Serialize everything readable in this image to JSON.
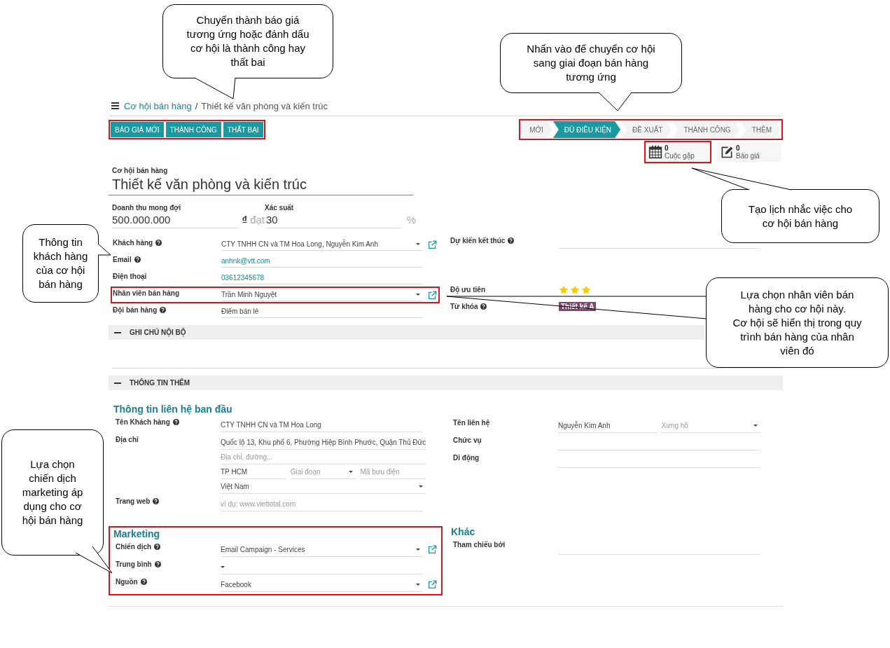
{
  "breadcrumb": {
    "parent": "Cơ hội bán hàng",
    "separator": "/",
    "current": "Thiết kế văn phòng và kiến trúc"
  },
  "action_bar": {
    "highlighted": true,
    "buttons": [
      "BÁO GIÁ MỚI",
      "THÀNH CÔNG",
      "THẤT BẠI"
    ]
  },
  "stage_bar": {
    "highlighted": true,
    "stages": [
      {
        "label": "MỚI",
        "selected": false
      },
      {
        "label": "ĐỦ ĐIỀU KIỆN",
        "selected": true
      },
      {
        "label": "ĐỀ XUẤT",
        "selected": false
      },
      {
        "label": "THÀNH CÔNG",
        "selected": false
      },
      {
        "label": "THÊM",
        "selected": false
      }
    ]
  },
  "smart_buttons": [
    {
      "kind": "calendar",
      "count": "0",
      "label": "Cuộc gặp",
      "highlighted": true
    },
    {
      "kind": "quote",
      "count": "0",
      "label": "Báo giá",
      "highlighted": false
    }
  ],
  "opportunity": {
    "label": "Cơ hội bán hàng",
    "title": "Thiết kế văn phòng và kiến trúc"
  },
  "revenue": {
    "label": "Doanh thu mong đợi",
    "value": "500.000.000",
    "currency": "₫",
    "connector": "đạt"
  },
  "probability": {
    "label": "Xác suất",
    "value": "30",
    "unit": "%"
  },
  "main_fields": {
    "left": [
      {
        "label": "Khách hàng",
        "help": true,
        "external_link": true,
        "highlighted": false,
        "inputs": [
          {
            "value": "CTY TNHH CN và TM Hoa Long, Nguyễn Kim Anh",
            "dropdown": true
          }
        ]
      },
      {
        "label": "Email",
        "help": true,
        "external_link": false,
        "highlighted": false,
        "inputs": [
          {
            "value": "anhnk@vtt.com",
            "link": true,
            "dropdown": false
          }
        ]
      },
      {
        "label": "Điện thoại",
        "help": false,
        "external_link": false,
        "highlighted": false,
        "inputs": [
          {
            "value": "03612345678",
            "link": true,
            "dropdown": false
          }
        ]
      },
      {
        "label": "Nhân viên bán hàng",
        "help": false,
        "external_link": true,
        "highlighted": true,
        "inputs": [
          {
            "value": "Trần Minh Nguyệt",
            "dropdown": true
          }
        ]
      },
      {
        "label": "Đội bán hàng",
        "help": true,
        "external_link": false,
        "highlighted": false,
        "inputs": [
          {
            "value": "Điểm bán lẻ",
            "dropdown": false
          }
        ]
      }
    ],
    "right": [
      {
        "label": "Dự kiến kết thúc",
        "help": true,
        "inputs": [
          {
            "dropdown": false
          }
        ]
      },
      {
        "label": "Độ ưu tiên",
        "help": false,
        "stars": 3
      },
      {
        "label": "Từ khóa",
        "help": true,
        "tags": [
          "Thiết kế A"
        ]
      }
    ]
  },
  "sections": [
    {
      "title": "GHI CHÚ NỘI BỘ",
      "expanded": true
    },
    {
      "title": "THÔNG TIN THÊM",
      "expanded": true
    }
  ],
  "extra_groups": [
    {
      "left": {
        "heading": "Thông tin liên hệ ban đầu",
        "highlighted": false,
        "fields": [
          {
            "label": "Tên Khách hàng",
            "help": true,
            "inputs": [
              {
                "value": "CTY TNHH CN và TM Hoa Long",
                "dropdown": false
              }
            ]
          },
          {
            "label": "Địa chỉ",
            "help": false,
            "lines": [
              [
                {
                  "value": "Quốc lộ 13, Khu phố 6, Phường Hiệp Bình Phước, Quận Thủ Đức",
                  "dropdown": false
                }
              ],
              [
                {
                  "placeholder": "Địa chỉ, đường...",
                  "dropdown": false
                }
              ],
              [
                {
                  "value": "TP HCM",
                  "dropdown": false
                },
                {
                  "placeholder": "Giai đoạn",
                  "dropdown": true
                },
                {
                  "placeholder": "Mã bưu điện",
                  "dropdown": false
                }
              ],
              [
                {
                  "value": "Việt Nam",
                  "dropdown": true
                }
              ]
            ]
          },
          {
            "label": "Trang web",
            "help": true,
            "inputs": [
              {
                "placeholder": "ví dụ: www.viettotal.com",
                "dropdown": false
              }
            ]
          }
        ]
      },
      "right": {
        "fields": [
          {
            "label": "Tên liên hệ",
            "help": false,
            "inputs": [
              {
                "value": "Nguyễn Kim Anh",
                "dropdown": false
              },
              {
                "placeholder": "Xưng hô",
                "dropdown": true
              }
            ]
          },
          {
            "label": "Chức vụ",
            "help": false,
            "inputs": [
              {
                "dropdown": false
              }
            ]
          },
          {
            "label": "Di động",
            "help": false,
            "inputs": [
              {
                "dropdown": false
              }
            ]
          }
        ]
      }
    },
    {
      "left": {
        "heading": "Marketing",
        "highlighted": true,
        "fields": [
          {
            "label": "Chiến dịch",
            "help": true,
            "external_link": true,
            "inputs": [
              {
                "value": "Email Campaign - Services",
                "dropdown": true
              }
            ]
          },
          {
            "label": "Trung bình",
            "help": true,
            "external_link": false,
            "inputs": [
              {
                "dropdown": true
              }
            ]
          },
          {
            "label": "Nguồn",
            "help": true,
            "external_link": true,
            "inputs": [
              {
                "value": "Facebook",
                "dropdown": true
              }
            ]
          }
        ]
      },
      "right": {
        "heading": "Khác",
        "fields": [
          {
            "label": "Tham chiếu bởi",
            "help": false,
            "inputs": [
              {
                "dropdown": false
              }
            ]
          }
        ]
      }
    }
  ],
  "callouts": [
    {
      "text": "Chuyển thành báo giá\ntương ứng hoặc đánh dấu\ncơ hội là thành công hay\nthất bai"
    },
    {
      "text": "Nhấn vào để chuyển cơ hội\nsang giai đoạn bán hàng\ntương ứng"
    },
    {
      "text": "Tạo lịch nhắc việc cho\ncơ hội bán hàng"
    },
    {
      "text": "Thông tin\nkhách hàng\ncủa cơ hội\nbán hàng"
    },
    {
      "text": "Lựa chọn nhân viên bán\nhàng cho cơ hội này.\nCơ hội sẽ hiển thị trong quy\ntrình bán hàng của nhân\nviên đó"
    },
    {
      "text": "Lựa chọn\nchiến dịch\nmarketing áp\ndụng cho cơ\nhội bán hàng"
    }
  ]
}
